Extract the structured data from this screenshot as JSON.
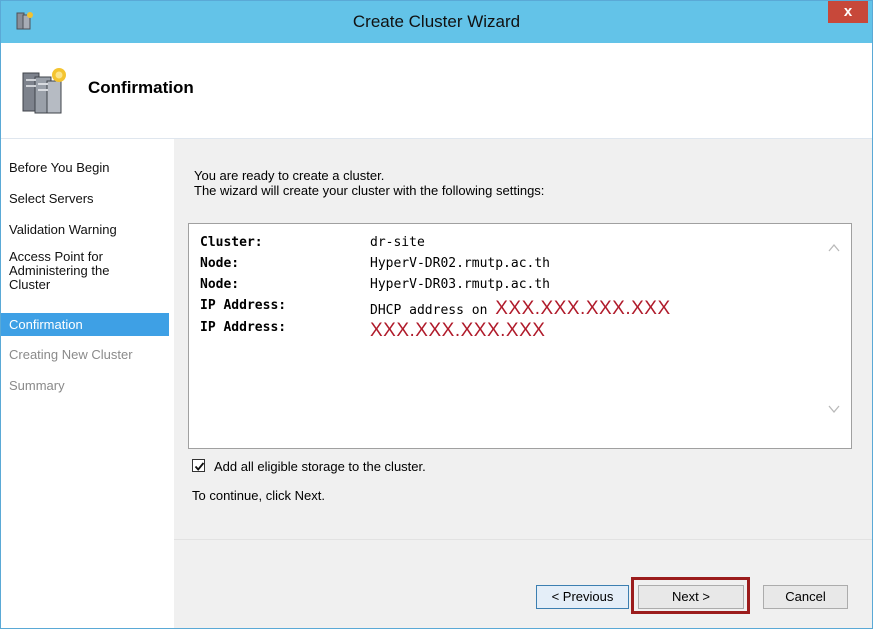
{
  "window": {
    "title": "Create Cluster Wizard",
    "close_label": "x"
  },
  "header": {
    "title": "Confirmation"
  },
  "sidebar": {
    "items": [
      {
        "label": "Before You Begin",
        "state": "normal"
      },
      {
        "label": "Select Servers",
        "state": "normal"
      },
      {
        "label": "Validation Warning",
        "state": "normal"
      },
      {
        "label": "Access Point for Administering the Cluster",
        "state": "normal"
      },
      {
        "label": "Confirmation",
        "state": "active"
      },
      {
        "label": "Creating New Cluster",
        "state": "disabled"
      },
      {
        "label": "Summary",
        "state": "disabled"
      }
    ]
  },
  "main": {
    "intro_line1": "You are ready to create a cluster.",
    "intro_line2": "The wizard will create your cluster with the following settings:",
    "settings": [
      {
        "label": "Cluster:",
        "value": "dr-site"
      },
      {
        "label": "Node:",
        "value": "HyperV-DR02.rmutp.ac.th"
      },
      {
        "label": "Node:",
        "value": "HyperV-DR03.rmutp.ac.th"
      },
      {
        "label": "IP Address:",
        "prefix": "DHCP address on ",
        "redacted": "XXX.XXX.XXX.XXX"
      },
      {
        "label": "IP Address:",
        "redacted": "XXX.XXX.XXX.XXX"
      }
    ],
    "checkbox_label": "Add all eligible storage to the cluster.",
    "checkbox_checked": true,
    "continue_text": "To continue, click Next."
  },
  "buttons": {
    "previous": "< Previous",
    "next": "Next >",
    "cancel": "Cancel"
  },
  "colors": {
    "titlebar": "#63c3e8",
    "nav_active": "#3ea0e5",
    "redacted_text": "#b01b2b",
    "highlight_border": "#9b1c1c"
  }
}
